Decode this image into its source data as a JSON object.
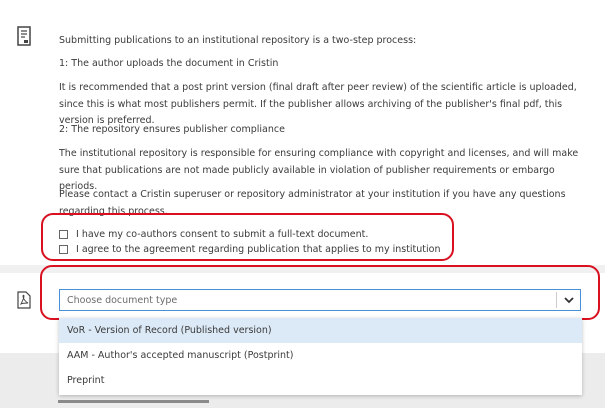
{
  "info": {
    "intro": "Submitting publications to an institutional repository is a two-step process:",
    "step1_title": "1: The author uploads the document in Cristin",
    "step1_body": "It is recommended that a post print version (final draft after peer review) of the scientific article is uploaded, since this is what most publishers permit. If the publisher allows archiving of the publisher's final pdf, this version is preferred.",
    "step2_title": "2: The repository ensures publisher compliance",
    "step2_body": "The institutional repository is responsible for ensuring compliance with copyright and licenses, and will make sure that publications are not made publicly available in violation of publisher requirements or embargo periods.",
    "contact": "Please contact a Cristin superuser or repository administrator at your institution if you have any questions regarding this process."
  },
  "consents": [
    {
      "label": "I have my co-authors consent to submit a full-text document.",
      "checked": false
    },
    {
      "label": "I agree to the agreement regarding publication that applies to my institution",
      "checked": false
    }
  ],
  "document_type": {
    "placeholder": "Choose document type",
    "options": [
      "VoR - Version of Record (Published version)",
      "AAM - Author's accepted manuscript (Postprint)",
      "Preprint"
    ],
    "highlighted_index": 0
  },
  "colors": {
    "highlight_outline": "#d81020",
    "focus_border": "#4a90d9",
    "option_highlight": "#dce9f6"
  },
  "icons": [
    "document-icon",
    "pdf-icon",
    "chevron-down-icon"
  ]
}
